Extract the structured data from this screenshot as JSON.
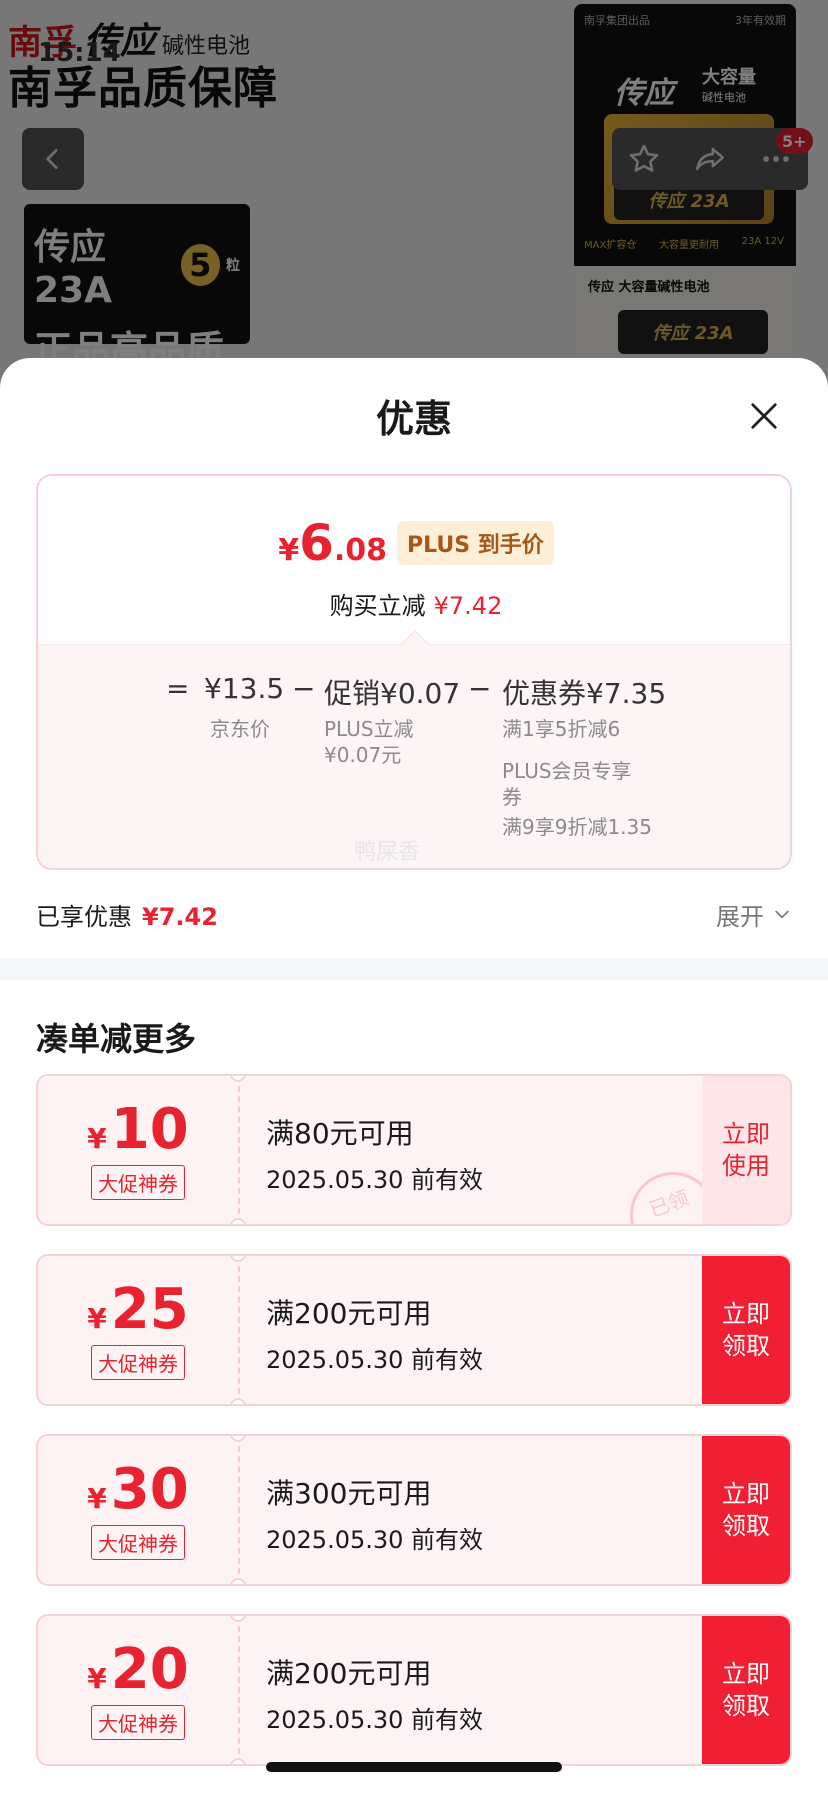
{
  "background": {
    "brand_name": "南孚",
    "brand_logo": "传应",
    "brand_sub": "碱性电池",
    "guarantee": "南孚品质保障",
    "time_ghost": "15:14",
    "promo_line1": "传应23A",
    "promo_count": "5",
    "promo_unit": "粒",
    "promo_line2": "正品高品质",
    "pack_top_left": "南孚集团出品",
    "pack_top_right": "3年有效期",
    "pack_logo": "传应",
    "pack_caption": "大容量",
    "pack_caption_sub": "碱性电池",
    "pack_battery": "传应 23A",
    "pack_strip_left": "MAX扩容仓",
    "pack_strip_mid": "大容量更耐用",
    "pack_strip_right": "23A 12V",
    "pack_white_title": "传应 大容量碱性电池",
    "pack_battery2": "传应 23A",
    "cart_badge": "5+"
  },
  "sheet": {
    "title": "优惠",
    "final_price": {
      "currency": "¥",
      "int": "6",
      "dec": ".08"
    },
    "plus_tag": "PLUS 到手价",
    "reduce_label": "购买立减",
    "reduce_amount": "¥7.42",
    "formula": {
      "eq": "=",
      "jd_price": "¥13.5",
      "minus1": "−",
      "promo": "促销¥0.07",
      "minus2": "−",
      "coupon": "优惠券¥7.35"
    },
    "sub": {
      "jd_label": "京东价",
      "plus_reduce": "PLUS立减\n¥0.07元",
      "coupon_line1": "满1享5折减6",
      "coupon_line2": "PLUS会员专享\n券",
      "coupon_line3": "满9享9折减1.35"
    },
    "watermark": "鸭屎香",
    "enjoyed_label": "已享优惠",
    "enjoyed_amount": "¥7.42",
    "expand_label": "展开",
    "section_title": "凑单减更多",
    "coupons": [
      {
        "currency": "¥",
        "amount": "10",
        "tag": "大促神券",
        "condition": "满80元可用",
        "valid": "2025.05.30 前有效",
        "action": "立即使用",
        "stamp": "已领"
      },
      {
        "currency": "¥",
        "amount": "25",
        "tag": "大促神券",
        "condition": "满200元可用",
        "valid": "2025.05.30 前有效",
        "action": "立即领取"
      },
      {
        "currency": "¥",
        "amount": "30",
        "tag": "大促神券",
        "condition": "满300元可用",
        "valid": "2025.05.30 前有效",
        "action": "立即领取"
      },
      {
        "currency": "¥",
        "amount": "20",
        "tag": "大促神券",
        "condition": "满200元可用",
        "valid": "2025.05.30 前有效",
        "action": "立即领取"
      }
    ]
  },
  "colors": {
    "accent_red": "#e8232f",
    "claim_bg": "#f01f34",
    "plus_tag_bg": "#fdeed7",
    "plus_tag_text": "#a3581a"
  }
}
